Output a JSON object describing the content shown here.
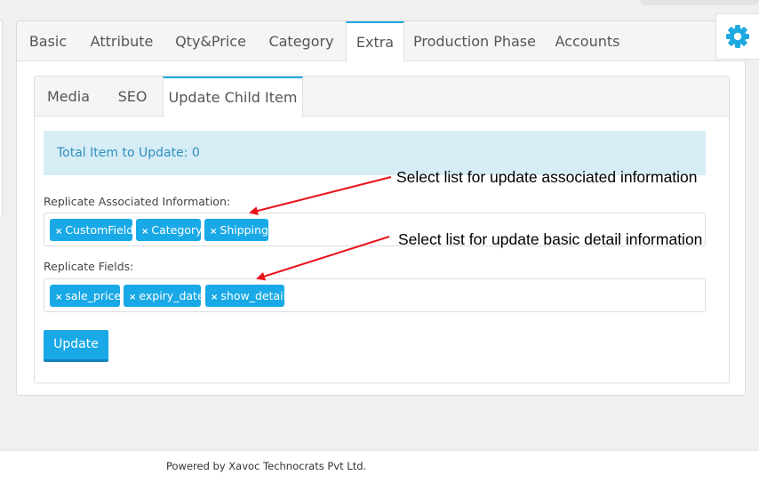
{
  "main_tabs": [
    {
      "label": "Basic"
    },
    {
      "label": "Attribute"
    },
    {
      "label": "Qty&Price"
    },
    {
      "label": "Category"
    },
    {
      "label": "Extra",
      "active": true
    },
    {
      "label": "Production Phase"
    },
    {
      "label": "Accounts"
    }
  ],
  "sub_tabs": [
    {
      "label": "Media"
    },
    {
      "label": "SEO"
    },
    {
      "label": "Update Child Item",
      "active": true
    }
  ],
  "info_text": "Total Item to Update: 0",
  "associated": {
    "label": "Replicate Associated Information:",
    "chips": [
      "CustomField",
      "Category",
      "Shipping"
    ]
  },
  "fields": {
    "label": "Replicate Fields:",
    "chips": [
      "sale_price",
      "expiry_date",
      "show_detail"
    ]
  },
  "chip_remove_glyph": "×",
  "update_button": "Update",
  "annotations": [
    "Select list for update associated information",
    "Select list for update basic detail information"
  ],
  "footer_text": "Powered by Xavoc Technocrats Pvt Ltd.",
  "settings_icon": "gear-icon",
  "colors": {
    "accent": "#19a9e6",
    "info_bg": "#d6edf5",
    "info_text": "#2e8fbf",
    "arrow": "#e8141b"
  }
}
